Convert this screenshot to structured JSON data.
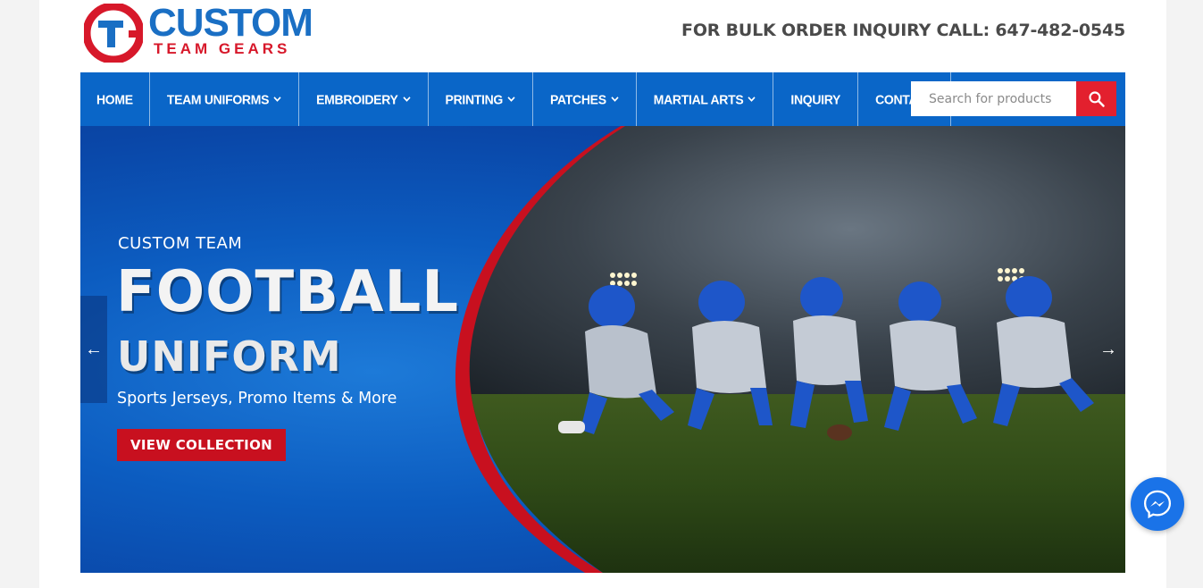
{
  "brand": {
    "name_line1": "CUSTOM",
    "name_line2": "TEAM GEARS",
    "mark_letters": "CTG"
  },
  "header": {
    "phone_text": "FOR BULK ORDER INQUIRY CALL: 647-482-0545"
  },
  "nav": {
    "items": [
      {
        "label": "HOME",
        "dropdown": false
      },
      {
        "label": "TEAM UNIFORMS",
        "dropdown": true
      },
      {
        "label": "EMBROIDERY",
        "dropdown": true
      },
      {
        "label": "PRINTING",
        "dropdown": true
      },
      {
        "label": "PATCHES",
        "dropdown": true
      },
      {
        "label": "MARTIAL ARTS",
        "dropdown": true
      },
      {
        "label": "INQUIRY",
        "dropdown": false
      },
      {
        "label": "CONTACT",
        "dropdown": false
      }
    ],
    "search_placeholder": "Search for products",
    "search_icon": "search-icon"
  },
  "hero": {
    "kicker": "CUSTOM TEAM",
    "title_line1": "FOOTBALL",
    "title_line2": "UNIFORM",
    "subtitle": "Sports Jerseys, Promo Items & More",
    "cta_label": "VIEW COLLECTION",
    "prev_arrow": "←",
    "next_arrow": "→"
  },
  "colors": {
    "nav_blue": "#0a66c8",
    "accent_red": "#e3202e",
    "cta_red": "#c8101f",
    "brand_blue": "#1a6fc4"
  },
  "floating": {
    "chat_icon": "messenger-icon"
  }
}
